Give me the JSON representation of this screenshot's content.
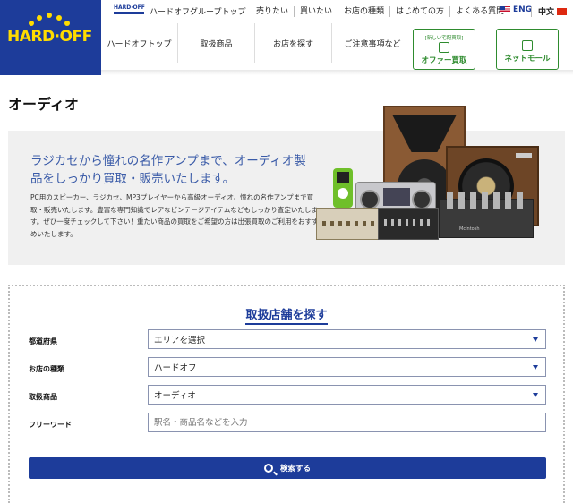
{
  "brand": {
    "logo_text": "HARD·OFF",
    "group_logo_text": "HARD·OFF",
    "group_top_label": "ハードオフグループトップ"
  },
  "top_links": [
    "売りたい",
    "買いたい",
    "お店の種類",
    "はじめての方",
    "よくある質問"
  ],
  "lang": {
    "en": "ENG",
    "zh": "中文"
  },
  "nav": {
    "items": [
      "ハードオフトップ",
      "取扱商品",
      "お店を探す",
      "ご注意事項など"
    ],
    "offer_tag": "[新しい宅配買取]",
    "offer_label": "オファー買取",
    "netmall_label": "ネットモール"
  },
  "page_title": "オーディオ",
  "hero": {
    "headline": "ラジカセから憧れの名作アンプまで、オーディオ製品をしっかり買取・販売いたします。",
    "body": "PC用のスピーカー、ラジカセ、MP3プレイヤーから高級オーディオ、憧れの名作アンプまで買取・販売いたします。豊富な専門知識でレアなビンテージアイテムなどもしっかり査定いたします。ぜひ一度チェックして下さい！重たい商品の買取をご希望の方は出張買取のご利用をおすすめいたします。",
    "amp_brand": "McIntosh"
  },
  "search": {
    "title": "取扱店舗を探す",
    "prefecture_label": "都道府県",
    "prefecture_value": "エリアを選択",
    "shop_type_label": "お店の種類",
    "shop_type_value": "ハードオフ",
    "product_label": "取扱商品",
    "product_value": "オーディオ",
    "freeword_label": "フリーワード",
    "freeword_placeholder": "駅名・商品名などを入力",
    "button_label": "検索する"
  },
  "colors": {
    "brand_blue": "#1d3c9a",
    "brand_yellow": "#ffdc00",
    "green": "#2e8b2e",
    "headline_blue": "#3a5ba8"
  }
}
